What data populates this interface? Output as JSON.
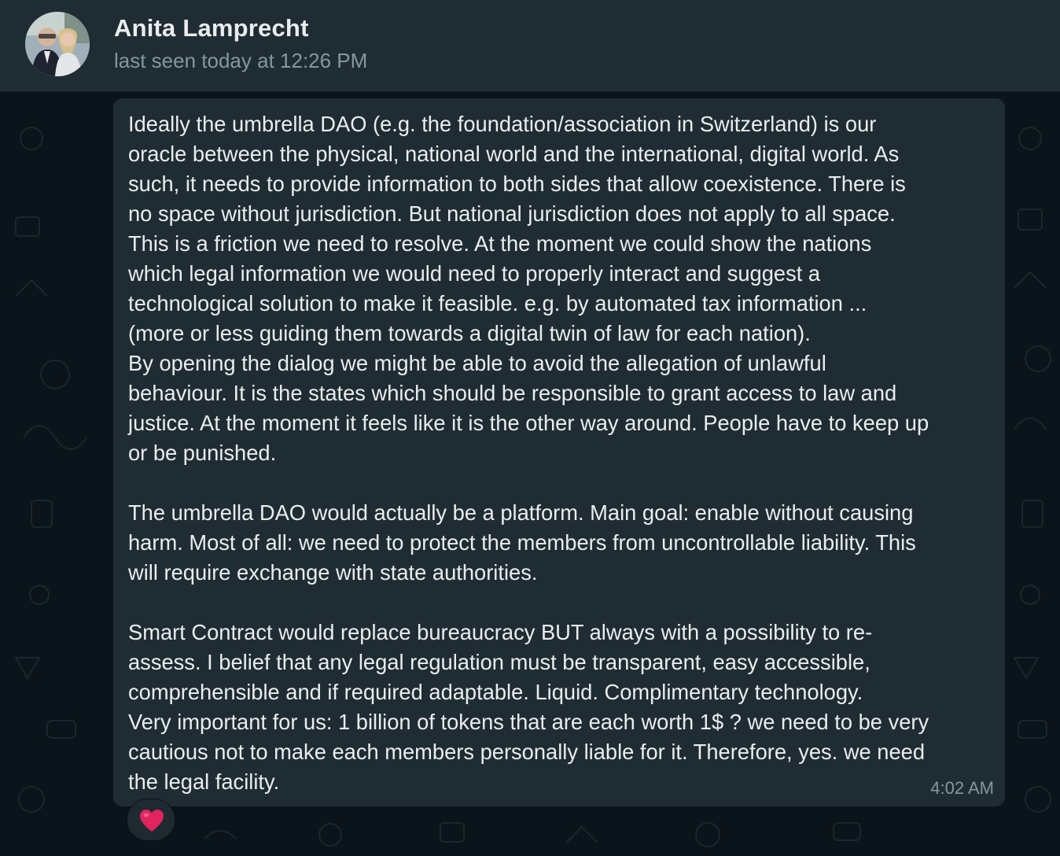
{
  "header": {
    "contact_name": "Anita Lamprecht",
    "status": "last seen today at 12:26 PM",
    "avatar_icon": "avatar-photo-icon"
  },
  "message": {
    "text": "Ideally the umbrella DAO (e.g. the foundation/association in Switzerland) is our\noracle between the physical, national world and the international, digital world. As\nsuch, it needs to provide information to both sides that allow coexistence. There is\nno space without jurisdiction. But national jurisdiction does not apply to all space.\nThis is a friction we need to resolve. At the moment we could show the nations\nwhich legal information we would need to properly interact and suggest a\ntechnological solution to make it feasible. e.g. by automated tax information ...\n(more or less guiding them towards a digital twin of law for each nation).\nBy opening the dialog we might be able to avoid the allegation of unlawful\nbehaviour. It is the states which should be responsible to grant access to law and\njustice. At the moment it feels like it is the other way around. People have to keep up\nor be punished.\n\nThe umbrella DAO would actually be a platform. Main goal: enable without causing\nharm. Most of all: we need to protect the members from uncontrollable liability. This\nwill require exchange with state authorities.\n\nSmart Contract would replace bureaucracy BUT always with a possibility to re-\nassess. I belief that any legal regulation must be transparent, easy accessible,\ncomprehensible and if required adaptable. Liquid. Complimentary technology.\nVery important for us: 1 billion of tokens that are each worth 1$ ? we need to be very\ncautious not to make each members personally liable for it. Therefore, yes. we need\nthe legal facility.",
    "time": "4:02 AM",
    "reaction_icon": "red-heart-icon"
  },
  "colors": {
    "header_bg": "#202c33",
    "chat_bg": "#0b141a",
    "bubble_bg": "#202c33",
    "primary_text": "#e9edef",
    "secondary_text": "#8696a0",
    "heart": "#e0245e"
  }
}
